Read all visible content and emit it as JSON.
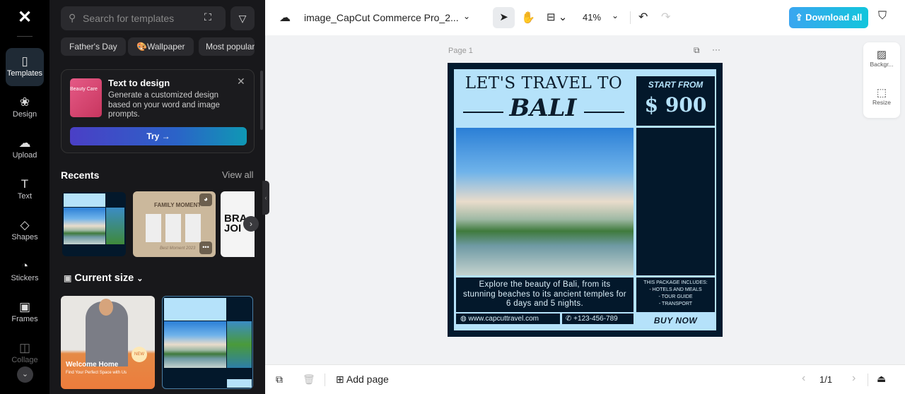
{
  "rail": {
    "items": [
      {
        "label": "Templates",
        "icon": "templates-icon"
      },
      {
        "label": "Design",
        "icon": "design-icon"
      },
      {
        "label": "Upload",
        "icon": "upload-icon"
      },
      {
        "label": "Text",
        "icon": "text-icon"
      },
      {
        "label": "Shapes",
        "icon": "shapes-icon"
      },
      {
        "label": "Stickers",
        "icon": "stickers-icon"
      },
      {
        "label": "Frames",
        "icon": "frames-icon"
      },
      {
        "label": "Collage",
        "icon": "collage-icon"
      }
    ]
  },
  "panel": {
    "search_placeholder": "Search for templates",
    "chips": [
      "Father's Day",
      "Wallpaper",
      "Most popular"
    ],
    "promo": {
      "title": "Text to design",
      "desc": "Generate a customized design based on your word and image prompts.",
      "thumb_text": "Beauty Care",
      "button": "Try →"
    },
    "recents": {
      "title": "Recents",
      "view_all": "View all",
      "family_title": "FAMILY MOMENT",
      "family_sub": "Best Moment 2023",
      "brand_text": "BRA JOI"
    },
    "current_size": {
      "title": "Current size",
      "welcome_title": "Welcome Home",
      "welcome_sub": "Find Your Perfect Space with Us",
      "badge": "NEW"
    }
  },
  "topbar": {
    "filename": "image_CapCut Commerce Pro_2...",
    "zoom": "41%",
    "download": "Download all"
  },
  "canvas": {
    "page_label": "Page 1",
    "side_tools": [
      {
        "label": "Backgr..."
      },
      {
        "label": "Resize"
      }
    ]
  },
  "poster": {
    "heading1": "LET'S TRAVEL TO",
    "heading2": "BALI",
    "start_from": "START FROM",
    "price": "$ 900",
    "desc": "Explore the beauty of Bali, from its stunning beaches to its ancient temples for 6 days and 5 nights.",
    "pkg_title": "THIS PACKAGE INCLUDES:",
    "pkg_items": [
      "- HOTELS AND MEALS",
      "- TOUR GUIDE",
      "- TRANSPORT"
    ],
    "website": "www.capcuttravel.com",
    "phone": "+123-456-789",
    "cta": "BUY NOW"
  },
  "bottombar": {
    "add_page": "Add page",
    "page_count": "1/1"
  },
  "colors": {
    "accent": "#1fa8e8",
    "poster_dark": "#03182b",
    "poster_light": "#b5e2fa"
  }
}
